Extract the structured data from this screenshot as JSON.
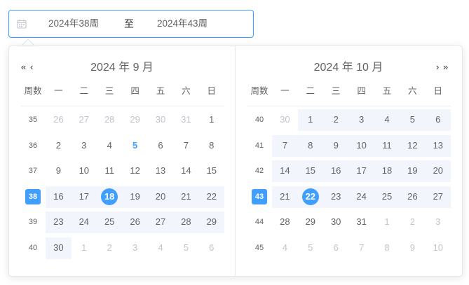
{
  "range_input": {
    "start_value": "2024年38周",
    "separator": "至",
    "end_value": "2024年43周"
  },
  "colors": {
    "primary": "#409eff",
    "range_bg": "#f2f6fc",
    "muted": "#c0c4cc"
  },
  "week_header": "周数",
  "weekdays": [
    "一",
    "二",
    "三",
    "四",
    "五",
    "六",
    "日"
  ],
  "panels": [
    {
      "title": "2024 年 9 月",
      "nav": [
        "«",
        "‹"
      ],
      "rows": [
        {
          "week": "35",
          "days": [
            [
              "26",
              "prev"
            ],
            [
              "27",
              "prev"
            ],
            [
              "28",
              "prev"
            ],
            [
              "29",
              "prev"
            ],
            [
              "30",
              "prev"
            ],
            [
              "31",
              "prev"
            ],
            [
              "1",
              "cur"
            ]
          ]
        },
        {
          "week": "36",
          "days": [
            [
              "2",
              "cur"
            ],
            [
              "3",
              "cur"
            ],
            [
              "4",
              "cur"
            ],
            [
              "5",
              "today"
            ],
            [
              "6",
              "cur"
            ],
            [
              "7",
              "cur"
            ],
            [
              "8",
              "cur"
            ]
          ]
        },
        {
          "week": "37",
          "days": [
            [
              "9",
              "cur"
            ],
            [
              "10",
              "cur"
            ],
            [
              "11",
              "cur"
            ],
            [
              "12",
              "cur"
            ],
            [
              "13",
              "cur"
            ],
            [
              "14",
              "cur"
            ],
            [
              "15",
              "cur"
            ]
          ]
        },
        {
          "week": "38",
          "selected_week": true,
          "range": [
            1,
            7
          ],
          "days": [
            [
              "16",
              "cur"
            ],
            [
              "17",
              "cur"
            ],
            [
              "18",
              "selected"
            ],
            [
              "19",
              "cur"
            ],
            [
              "20",
              "cur"
            ],
            [
              "21",
              "cur"
            ],
            [
              "22",
              "cur"
            ]
          ]
        },
        {
          "week": "39",
          "range": [
            1,
            7
          ],
          "days": [
            [
              "23",
              "cur"
            ],
            [
              "24",
              "cur"
            ],
            [
              "25",
              "cur"
            ],
            [
              "26",
              "cur"
            ],
            [
              "27",
              "cur"
            ],
            [
              "28",
              "cur"
            ],
            [
              "29",
              "cur"
            ]
          ]
        },
        {
          "week": "40",
          "range": [
            1,
            1
          ],
          "days": [
            [
              "30",
              "cur"
            ],
            [
              "1",
              "next"
            ],
            [
              "2",
              "next"
            ],
            [
              "3",
              "next"
            ],
            [
              "4",
              "next"
            ],
            [
              "5",
              "next"
            ],
            [
              "6",
              "next"
            ]
          ]
        }
      ]
    },
    {
      "title": "2024 年 10 月",
      "nav": [
        "›",
        "»"
      ],
      "rows": [
        {
          "week": "40",
          "range": [
            2,
            7
          ],
          "days": [
            [
              "30",
              "prev"
            ],
            [
              "1",
              "cur"
            ],
            [
              "2",
              "cur"
            ],
            [
              "3",
              "cur"
            ],
            [
              "4",
              "cur"
            ],
            [
              "5",
              "cur"
            ],
            [
              "6",
              "cur"
            ]
          ]
        },
        {
          "week": "41",
          "range": [
            1,
            7
          ],
          "days": [
            [
              "7",
              "cur"
            ],
            [
              "8",
              "cur"
            ],
            [
              "9",
              "cur"
            ],
            [
              "10",
              "cur"
            ],
            [
              "11",
              "cur"
            ],
            [
              "12",
              "cur"
            ],
            [
              "13",
              "cur"
            ]
          ]
        },
        {
          "week": "42",
          "range": [
            1,
            7
          ],
          "days": [
            [
              "14",
              "cur"
            ],
            [
              "15",
              "cur"
            ],
            [
              "16",
              "cur"
            ],
            [
              "17",
              "cur"
            ],
            [
              "18",
              "cur"
            ],
            [
              "19",
              "cur"
            ],
            [
              "20",
              "cur"
            ]
          ]
        },
        {
          "week": "43",
          "selected_week": true,
          "range": [
            1,
            7
          ],
          "days": [
            [
              "21",
              "cur"
            ],
            [
              "22",
              "selected"
            ],
            [
              "23",
              "cur"
            ],
            [
              "24",
              "cur"
            ],
            [
              "25",
              "cur"
            ],
            [
              "26",
              "cur"
            ],
            [
              "27",
              "cur"
            ]
          ]
        },
        {
          "week": "44",
          "days": [
            [
              "28",
              "cur"
            ],
            [
              "29",
              "cur"
            ],
            [
              "30",
              "cur"
            ],
            [
              "31",
              "cur"
            ],
            [
              "1",
              "next"
            ],
            [
              "2",
              "next"
            ],
            [
              "3",
              "next"
            ]
          ]
        },
        {
          "week": "45",
          "days": [
            [
              "4",
              "next"
            ],
            [
              "5",
              "next"
            ],
            [
              "6",
              "next"
            ],
            [
              "7",
              "next"
            ],
            [
              "8",
              "next"
            ],
            [
              "9",
              "next"
            ],
            [
              "10",
              "next"
            ]
          ]
        }
      ]
    }
  ]
}
